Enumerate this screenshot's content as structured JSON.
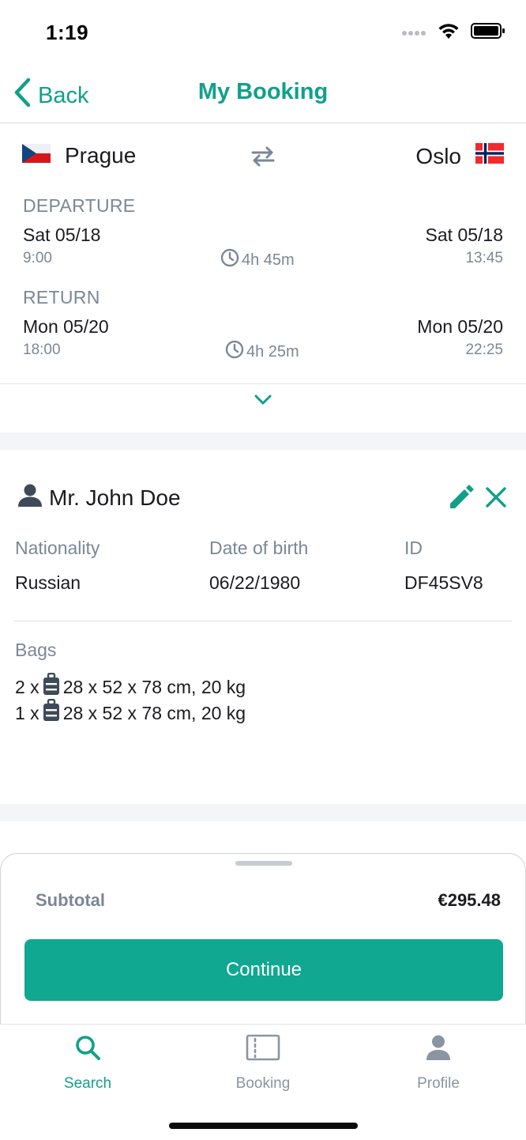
{
  "status_bar": {
    "time": "1:19"
  },
  "nav": {
    "back_label": "Back",
    "title": "My Booking"
  },
  "trip": {
    "from_city": "Prague",
    "from_flag": "czech-flag",
    "to_city": "Oslo",
    "to_flag": "norway-flag",
    "departure": {
      "label": "DEPARTURE",
      "out_date": "Sat 05/18",
      "out_time": "9:00",
      "duration": "4h 45m",
      "arr_date": "Sat 05/18",
      "arr_time": "13:45"
    },
    "return": {
      "label": "RETURN",
      "out_date": "Mon 05/20",
      "out_time": "18:00",
      "duration": "4h 25m",
      "arr_date": "Mon 05/20",
      "arr_time": "22:25"
    }
  },
  "passenger": {
    "name": "Mr. John Doe",
    "nationality_label": "Nationality",
    "nationality": "Russian",
    "dob_label": "Date of birth",
    "dob": "06/22/1980",
    "id_label": "ID",
    "id": "DF45SV8",
    "bags_label": "Bags",
    "bags": [
      {
        "count": "2 x",
        "spec": "28 x 52 x 78 cm, 20 kg"
      },
      {
        "count": "1 x",
        "spec": "28 x 52 x 78 cm, 20 kg"
      }
    ]
  },
  "checkout": {
    "subtotal_label": "Subtotal",
    "subtotal_value": "€295.48",
    "continue_label": "Continue"
  },
  "tabs": [
    {
      "label": "Search",
      "icon": "search-icon",
      "active": true
    },
    {
      "label": "Booking",
      "icon": "ticket-icon",
      "active": false
    },
    {
      "label": "Profile",
      "icon": "person-icon",
      "active": false
    }
  ],
  "colors": {
    "accent": "#10a08a",
    "button": "#10a890",
    "muted_text": "#7b8797",
    "band": "#f3f5f8"
  }
}
